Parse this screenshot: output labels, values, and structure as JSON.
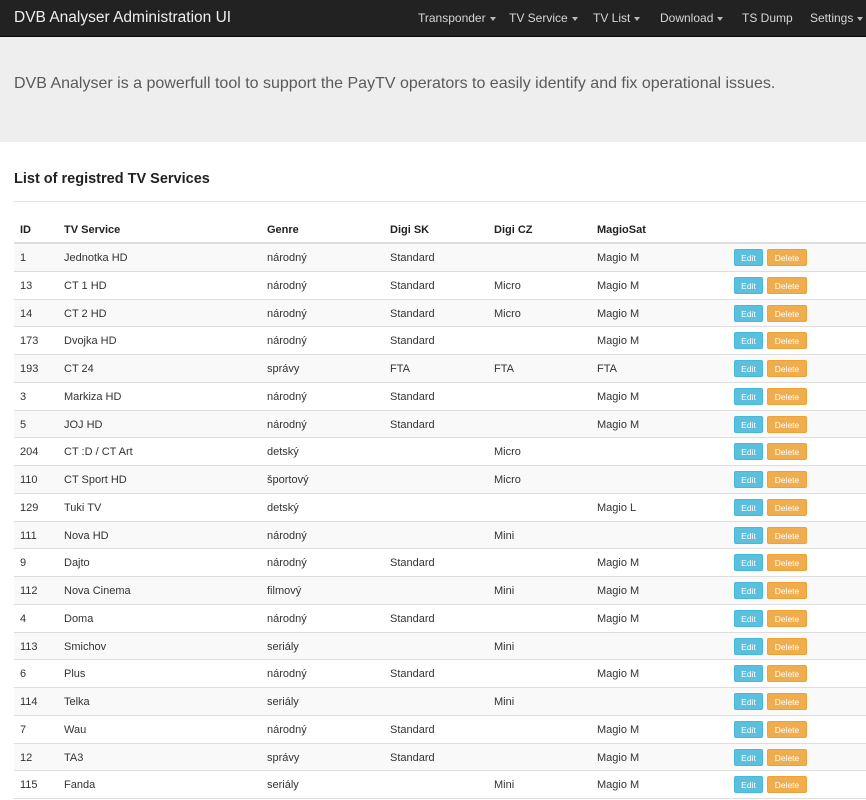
{
  "navbar": {
    "brand": "DVB Analyser Administration UI",
    "items": [
      {
        "label": "Transponder",
        "dropdown": true
      },
      {
        "label": "TV Service",
        "dropdown": true
      },
      {
        "label": "TV List",
        "dropdown": true
      },
      {
        "label": "Download",
        "dropdown": true
      },
      {
        "label": "TS Dump",
        "dropdown": false
      },
      {
        "label": "Settings",
        "dropdown": true
      }
    ]
  },
  "jumbotron": {
    "lead": "DVB Analyser is a powerfull tool to support the PayTV operators to easily identify and fix operational issues."
  },
  "section": {
    "title": "List of registred TV Services"
  },
  "table": {
    "columns": [
      "ID",
      "TV Service",
      "Genre",
      "Digi SK",
      "Digi CZ",
      "MagioSat"
    ],
    "edit_label": "Edit",
    "delete_label": "Delete",
    "rows": [
      [
        "1",
        "Jednotka HD",
        "národný",
        "Standard",
        "",
        "Magio M"
      ],
      [
        "13",
        "CT 1 HD",
        "národný",
        "Standard",
        "Micro",
        "Magio M"
      ],
      [
        "14",
        "CT 2 HD",
        "národný",
        "Standard",
        "Micro",
        "Magio M"
      ],
      [
        "173",
        "Dvojka HD",
        "národný",
        "Standard",
        "",
        "Magio M"
      ],
      [
        "193",
        "CT 24",
        "správy",
        "FTA",
        "FTA",
        "FTA"
      ],
      [
        "3",
        "Markiza HD",
        "národný",
        "Standard",
        "",
        "Magio M"
      ],
      [
        "5",
        "JOJ HD",
        "národný",
        "Standard",
        "",
        "Magio M"
      ],
      [
        "204",
        "CT :D / CT Art",
        "detský",
        "",
        "Micro",
        ""
      ],
      [
        "110",
        "CT Sport HD",
        "športový",
        "",
        "Micro",
        ""
      ],
      [
        "129",
        "Tuki TV",
        "detský",
        "",
        "",
        "Magio L"
      ],
      [
        "111",
        "Nova HD",
        "národný",
        "",
        "Mini",
        ""
      ],
      [
        "9",
        "Dajto",
        "národný",
        "Standard",
        "",
        "Magio M"
      ],
      [
        "112",
        "Nova Cinema",
        "filmový",
        "",
        "Mini",
        "Magio M"
      ],
      [
        "4",
        "Doma",
        "národný",
        "Standard",
        "",
        "Magio M"
      ],
      [
        "113",
        "Smichov",
        "seriály",
        "",
        "Mini",
        ""
      ],
      [
        "6",
        "Plus",
        "národný",
        "Standard",
        "",
        "Magio M"
      ],
      [
        "114",
        "Telka",
        "seriály",
        "",
        "Mini",
        ""
      ],
      [
        "7",
        "Wau",
        "národný",
        "Standard",
        "",
        "Magio M"
      ],
      [
        "12",
        "TA3",
        "správy",
        "Standard",
        "",
        "Magio M"
      ],
      [
        "115",
        "Fanda",
        "seriály",
        "",
        "Mini",
        "Magio M"
      ]
    ]
  }
}
